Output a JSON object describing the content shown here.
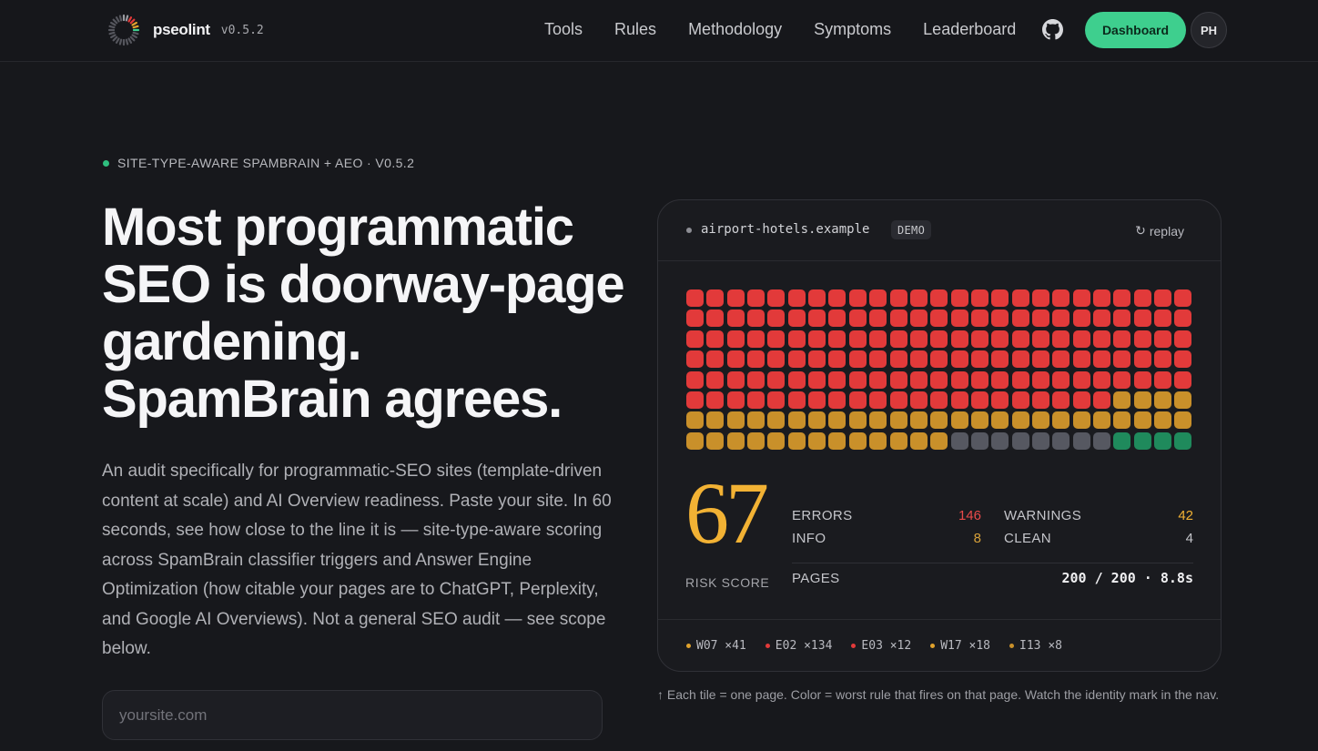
{
  "nav": {
    "brand": "pseolint",
    "version": "v0.5.2",
    "links": [
      "Tools",
      "Rules",
      "Methodology",
      "Symptoms",
      "Leaderboard"
    ],
    "github_icon": "github-icon",
    "dashboard_label": "Dashboard",
    "avatar_initials": "PH"
  },
  "hero": {
    "eyebrow": "SITE-TYPE-AWARE SPAMBRAIN + AEO · V0.5.2",
    "headline": "Most programmatic SEO is doorway-page gardening. SpamBrain agrees.",
    "lead": "An audit specifically for programmatic-SEO sites (template-driven content at scale) and AI Overview readiness. Paste your site. In 60 seconds, see how close to the line it is — site-type-aware scoring across SpamBrain classifier triggers and Answer Engine Optimization (how citable your pages are to ChatGPT, Perplexity, and Google AI Overviews). Not a general SEO audit — see scope below.",
    "input_placeholder": "yoursite.com",
    "input_value": ""
  },
  "demo": {
    "domain": "airport-hotels.example",
    "badge": "DEMO",
    "replay_label": "replay",
    "replay_icon": "refresh-icon",
    "tile_counts": {
      "error": 146,
      "warning": 42,
      "info": 8,
      "clean": 4
    },
    "colors": {
      "error": "#e23a3a",
      "warning": "#c9902a",
      "info": "#565861",
      "clean": "#1f8a5c",
      "score": "#f2b234",
      "accent": "#3ecf8e"
    },
    "score": "67",
    "score_label": "RISK SCORE",
    "stats": {
      "errors_label": "ERRORS",
      "errors_value": "146",
      "warnings_label": "WARNINGS",
      "warnings_value": "42",
      "info_label": "INFO",
      "info_value": "8",
      "clean_label": "CLEAN",
      "clean_value": "4",
      "pages_label": "PAGES",
      "pages_value": "200 / 200 · 8.8s"
    },
    "rules": [
      {
        "code": "W07 ×41",
        "color": "#e0a22c"
      },
      {
        "code": "E02 ×134",
        "color": "#e23a3a"
      },
      {
        "code": "E03 ×12",
        "color": "#e23a3a"
      },
      {
        "code": "W17 ×18",
        "color": "#e0a22c"
      },
      {
        "code": "I13 ×8",
        "color": "#c9902a"
      }
    ]
  },
  "caption": "↑ Each tile = one page. Color = worst rule that fires on that page. Watch the identity mark in the nav."
}
